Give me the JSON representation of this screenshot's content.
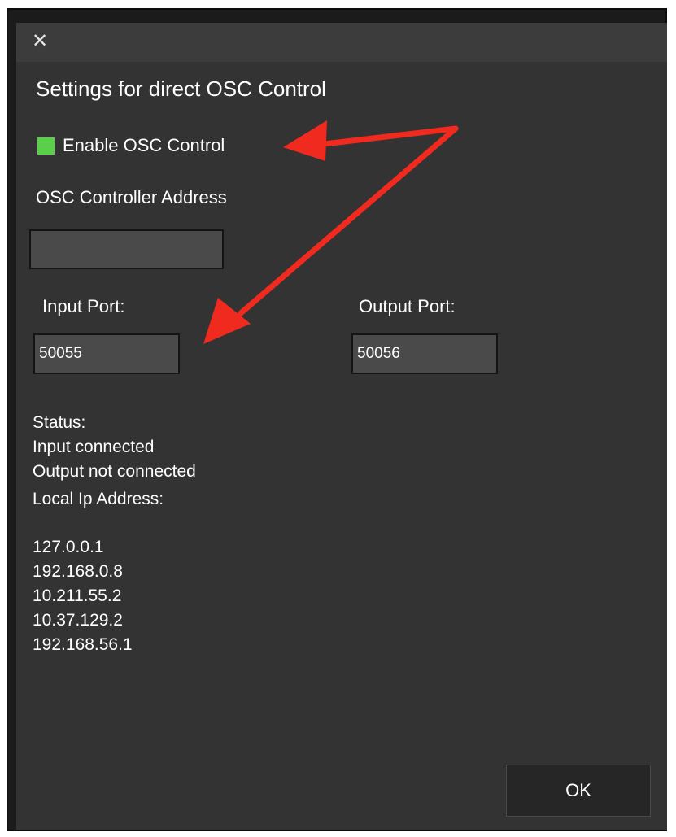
{
  "dialog": {
    "close_icon_glyph": "✕",
    "heading": "Settings for direct OSC Control"
  },
  "enable": {
    "label": "Enable OSC Control",
    "checked": true,
    "checkbox_color": "#5ad04a"
  },
  "controller_address": {
    "label": "OSC Controller Address",
    "value": ""
  },
  "input_port": {
    "label": "Input Port:",
    "value": "50055"
  },
  "output_port": {
    "label": "Output Port:",
    "value": "50056"
  },
  "status": {
    "heading": "Status:",
    "input": "Input connected",
    "output": "Output not connected"
  },
  "local_ip": {
    "label": "Local Ip Address:",
    "addresses": [
      "127.0.0.1",
      "192.168.0.8",
      "10.211.55.2",
      "10.37.129.2",
      "192.168.56.1"
    ]
  },
  "ok_button": {
    "label": "OK"
  },
  "annotation": {
    "arrow_color": "#f02a1e"
  }
}
